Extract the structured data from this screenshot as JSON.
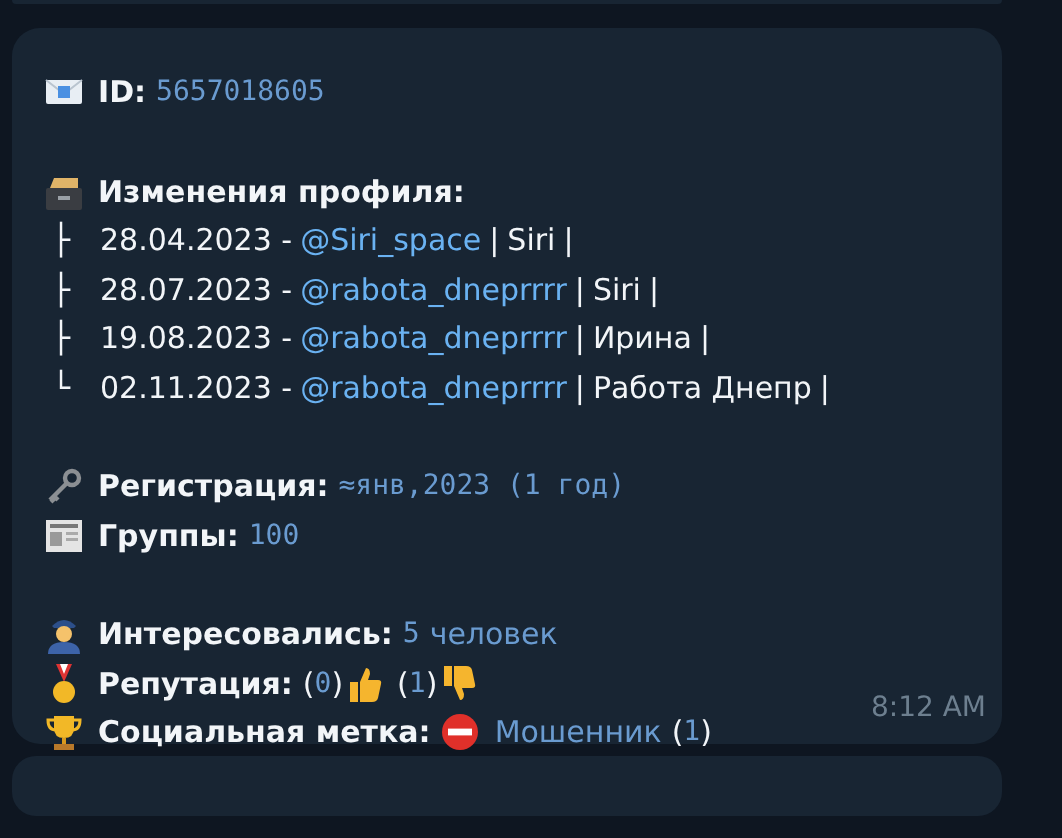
{
  "message": {
    "id": {
      "label": "ID:",
      "value": "5657018605"
    },
    "profile_changes": {
      "title": "Изменения профиля:",
      "entries": [
        {
          "branch": "├",
          "date": "28.04.2023 -",
          "username": "@Siri_space",
          "separator": "|",
          "name": "Siri",
          "end": "|"
        },
        {
          "branch": "├",
          "date": "28.07.2023 -",
          "username": "@rabota_dneprrrr",
          "separator": "|",
          "name": "Siri",
          "end": "|"
        },
        {
          "branch": "├",
          "date": "19.08.2023 -",
          "username": "@rabota_dneprrrr",
          "separator": "|",
          "name": "Ирина",
          "end": "|"
        },
        {
          "branch": "└",
          "date": "02.11.2023 -",
          "username": "@rabota_dneprrrr",
          "separator": "|",
          "name": "Работа Днепр",
          "end": "|"
        }
      ]
    },
    "registration": {
      "label": "Регистрация:",
      "value": "≈янв,2023 (1 год)"
    },
    "groups": {
      "label": "Группы:",
      "value": "100"
    },
    "interested": {
      "label": "Интересовались:",
      "count": "5",
      "unit": "человек"
    },
    "reputation": {
      "label": "Репутация:",
      "positive": "0",
      "negative": "1",
      "open": "(",
      "close": ")"
    },
    "social_tag": {
      "label": "Социальная метка:",
      "tag": "Мошенник",
      "count": "1",
      "open": "(",
      "close": ")"
    },
    "time": "8:12 AM"
  }
}
